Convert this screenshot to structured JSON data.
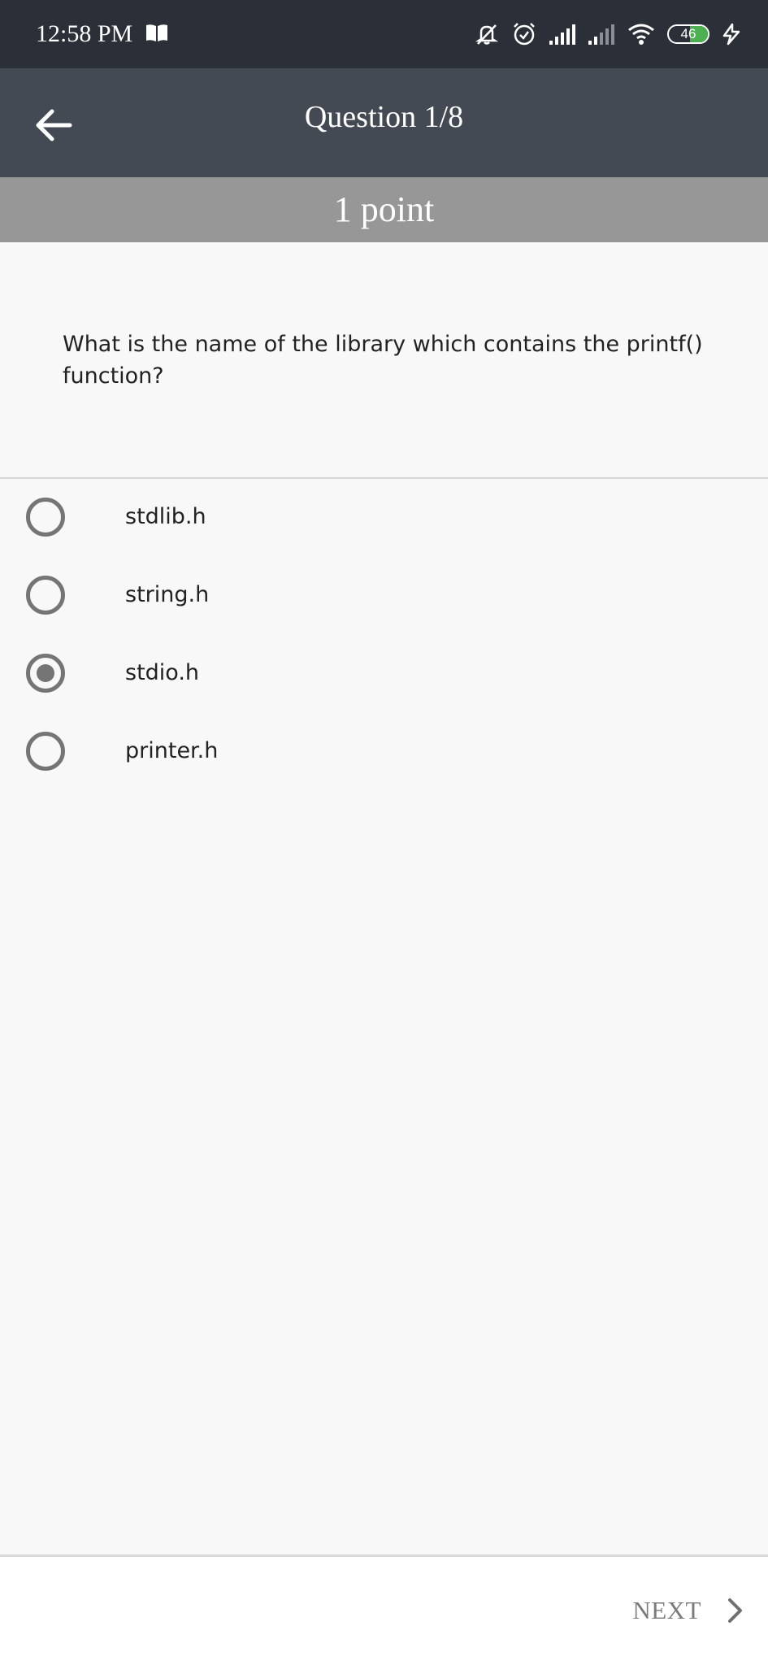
{
  "status_bar": {
    "time": "12:58 PM",
    "battery": "46",
    "battery_level": 0.46,
    "icons": [
      "book-icon",
      "bell-muted-icon",
      "alarm-icon",
      "signal-icon",
      "signal-weak-icon",
      "wifi-icon",
      "battery-icon",
      "charging-icon"
    ]
  },
  "app_bar": {
    "title": "Question 1/8",
    "back_icon": "arrow-left-icon"
  },
  "points": "1 point",
  "question": {
    "text": "What is the name of the library which contains the printf() function?"
  },
  "options": [
    {
      "label": "stdlib.h",
      "selected": false
    },
    {
      "label": "string.h",
      "selected": false
    },
    {
      "label": "stdio.h",
      "selected": true
    },
    {
      "label": "printer.h",
      "selected": false
    }
  ],
  "footer": {
    "next_label": "NEXT",
    "next_icon": "chevron-right-icon"
  },
  "colors": {
    "status_bar": "#2b3038",
    "app_bar": "#444a54",
    "point_bar": "#979797",
    "background": "#f8f8f8",
    "radio": "#757575"
  }
}
